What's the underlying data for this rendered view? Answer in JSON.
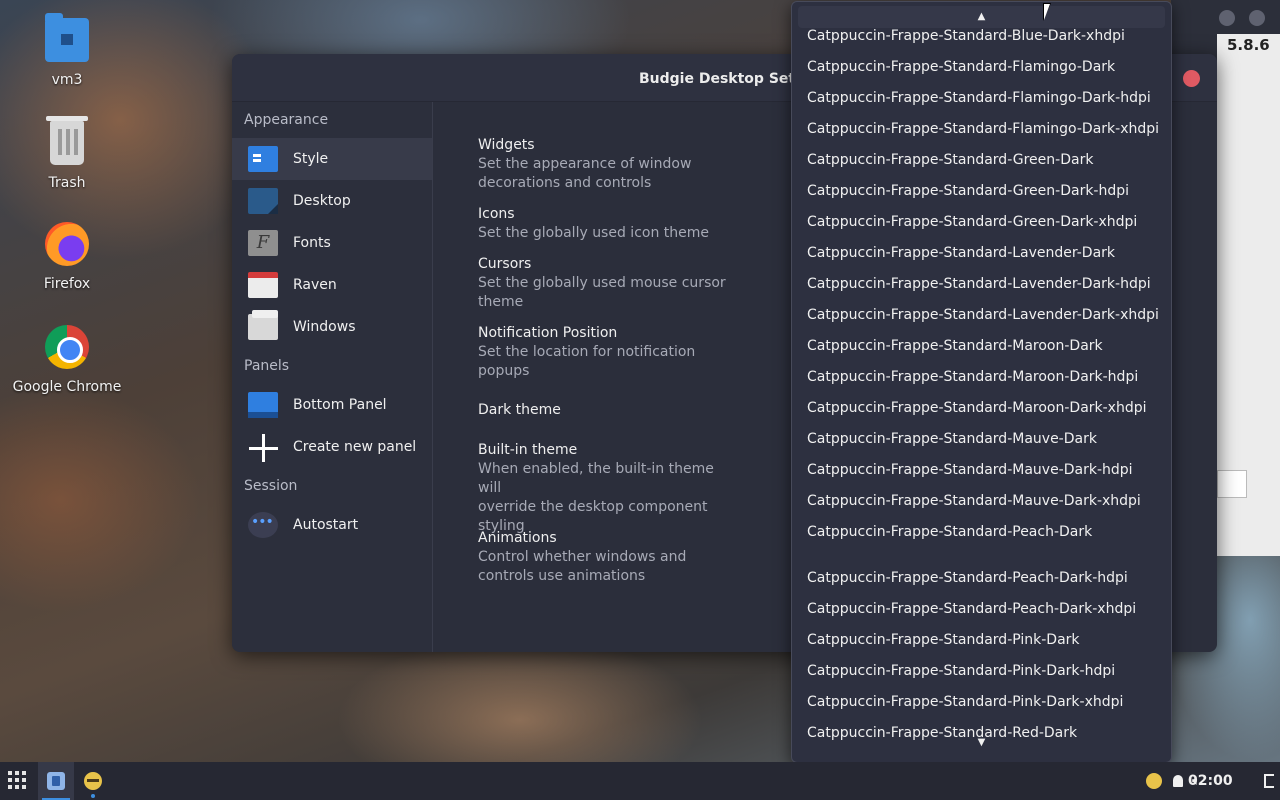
{
  "desktop": {
    "icons": [
      {
        "label": "vm3",
        "icon": "folder-home-icon"
      },
      {
        "label": "Trash",
        "icon": "trash-icon"
      },
      {
        "label": "Firefox",
        "icon": "firefox-icon"
      },
      {
        "label": "Google Chrome",
        "icon": "chrome-icon"
      }
    ]
  },
  "bg_window": {
    "version": "5.8.6"
  },
  "settings": {
    "title": "Budgie Desktop Settin",
    "sidebar": {
      "sections": [
        {
          "header": "Appearance",
          "items": [
            {
              "label": "Style",
              "active": true
            },
            {
              "label": "Desktop"
            },
            {
              "label": "Fonts",
              "glyph": "F"
            },
            {
              "label": "Raven"
            },
            {
              "label": "Windows"
            }
          ]
        },
        {
          "header": "Panels",
          "items": [
            {
              "label": "Bottom Panel"
            },
            {
              "label": "Create new panel"
            }
          ]
        },
        {
          "header": "Session",
          "items": [
            {
              "label": "Autostart"
            }
          ]
        }
      ]
    },
    "rows": [
      {
        "title": "Widgets",
        "desc1": "Set the appearance of window",
        "desc2": "decorations and controls",
        "desc3": ""
      },
      {
        "title": "Icons",
        "desc1": "Set the globally used icon theme",
        "desc2": "",
        "desc3": ""
      },
      {
        "title": "Cursors",
        "desc1": "Set the globally used mouse cursor",
        "desc2": "theme",
        "desc3": ""
      },
      {
        "title": "Notification Position",
        "desc1": "Set the location for notification",
        "desc2": "popups",
        "desc3": ""
      },
      {
        "title": "Dark theme",
        "desc1": "",
        "desc2": "",
        "desc3": ""
      },
      {
        "title": "Built-in theme",
        "desc1": "When enabled, the built-in theme will",
        "desc2": "override the desktop component",
        "desc3": "styling"
      },
      {
        "title": "Animations",
        "desc1": "Control whether windows and",
        "desc2": "controls use animations",
        "desc3": ""
      }
    ]
  },
  "popup": {
    "options": [
      "Catppuccin-Frappe-Standard-Blue-Dark-xhdpi",
      "Catppuccin-Frappe-Standard-Flamingo-Dark",
      "Catppuccin-Frappe-Standard-Flamingo-Dark-hdpi",
      "Catppuccin-Frappe-Standard-Flamingo-Dark-xhdpi",
      "Catppuccin-Frappe-Standard-Green-Dark",
      "Catppuccin-Frappe-Standard-Green-Dark-hdpi",
      "Catppuccin-Frappe-Standard-Green-Dark-xhdpi",
      "Catppuccin-Frappe-Standard-Lavender-Dark",
      "Catppuccin-Frappe-Standard-Lavender-Dark-hdpi",
      "Catppuccin-Frappe-Standard-Lavender-Dark-xhdpi",
      "Catppuccin-Frappe-Standard-Maroon-Dark",
      "Catppuccin-Frappe-Standard-Maroon-Dark-hdpi",
      "Catppuccin-Frappe-Standard-Maroon-Dark-xhdpi",
      "Catppuccin-Frappe-Standard-Mauve-Dark",
      "Catppuccin-Frappe-Standard-Mauve-Dark-hdpi",
      "Catppuccin-Frappe-Standard-Mauve-Dark-xhdpi",
      "Catppuccin-Frappe-Standard-Peach-Dark",
      "Catppuccin-Frappe-Standard-Peach-Dark-hdpi",
      "Catppuccin-Frappe-Standard-Peach-Dark-xhdpi",
      "Catppuccin-Frappe-Standard-Pink-Dark",
      "Catppuccin-Frappe-Standard-Pink-Dark-hdpi",
      "Catppuccin-Frappe-Standard-Pink-Dark-xhdpi",
      "Catppuccin-Frappe-Standard-Red-Dark"
    ],
    "up_arrow": "▲",
    "down_arrow": "▼"
  },
  "taskbar": {
    "clock": "02:00",
    "tray_icons": [
      "bee-icon",
      "bell-icon",
      "volume-icon",
      "logout-icon"
    ]
  },
  "colors": {
    "accent": "#3d8fe0",
    "close": "#e05a63",
    "window_bg": "#2b2e3b"
  }
}
